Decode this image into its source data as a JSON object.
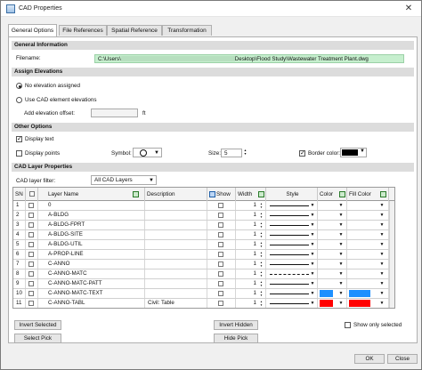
{
  "window": {
    "title": "CAD Properties",
    "close_glyph": "✕"
  },
  "tabs": [
    {
      "label": "General Options",
      "active": true
    },
    {
      "label": "File References"
    },
    {
      "label": "Spatial Reference"
    },
    {
      "label": "Transformation"
    }
  ],
  "general_info": {
    "header": "General Information",
    "filename_label": "Filename:",
    "filename_prefix": "C:\\Users\\",
    "filename_suffix": "Desktop\\Flood Study\\Wastewater Treatment Plant.dwg"
  },
  "elevations": {
    "header": "Assign Elevations",
    "opt_none": "No elevation assigned",
    "opt_cad": "Use CAD element elevations",
    "offset_label": "Add elevation offset:",
    "offset_value": "",
    "offset_unit": "ft"
  },
  "other": {
    "header": "Other Options",
    "display_text": "Display text",
    "display_points": "Display points",
    "symbol_label": "Symbol:",
    "size_label": "Size:",
    "size_value": "5",
    "border_label": "Border color:",
    "border_color": "#000000"
  },
  "layers": {
    "header": "CAD Layer Properties",
    "filter_label": "CAD layer filter:",
    "filter_value": "All CAD Layers",
    "columns": {
      "sn": "SN",
      "name": "Layer Name",
      "desc": "Description",
      "show": "Show",
      "width": "Width",
      "style": "Style",
      "color": "Color",
      "fill": "Fill Color"
    },
    "rows": [
      {
        "sn": "1",
        "name": "0",
        "desc": "",
        "width": "1",
        "style": "solid"
      },
      {
        "sn": "2",
        "name": "A-BLDG",
        "desc": "",
        "width": "1",
        "style": "solid"
      },
      {
        "sn": "3",
        "name": "A-BLDG-FPRT",
        "desc": "",
        "width": "1",
        "style": "solid"
      },
      {
        "sn": "4",
        "name": "A-BLDG-SITE",
        "desc": "",
        "width": "1",
        "style": "solid"
      },
      {
        "sn": "5",
        "name": "A-BLDG-UTIL",
        "desc": "",
        "width": "1",
        "style": "solid"
      },
      {
        "sn": "6",
        "name": "A-PROP-LINE",
        "desc": "",
        "width": "1",
        "style": "solid"
      },
      {
        "sn": "7",
        "name": "C-ANNO",
        "desc": "",
        "width": "1",
        "style": "solid"
      },
      {
        "sn": "8",
        "name": "C-ANNO-MATC",
        "desc": "",
        "width": "1",
        "style": "dashed"
      },
      {
        "sn": "9",
        "name": "C-ANNO-MATC-PATT",
        "desc": "",
        "width": "1",
        "style": "solid"
      },
      {
        "sn": "10",
        "name": "C-ANNO-MATC-TEXT",
        "desc": "",
        "width": "1",
        "style": "solid",
        "color": "#1e90ff",
        "fill": "#1e90ff"
      },
      {
        "sn": "11",
        "name": "C-ANNO-TABL",
        "desc": "Civil: Table",
        "width": "1",
        "style": "solid",
        "color": "#ff0000",
        "fill": "#ff0000"
      }
    ]
  },
  "buttons": {
    "invert_selected": "Invert Selected",
    "select_pick": "Select Pick",
    "invert_hidden": "Invert Hidden",
    "hide_pick": "Hide Pick",
    "show_only_selected": "Show only selected",
    "ok": "OK",
    "close": "Close"
  }
}
